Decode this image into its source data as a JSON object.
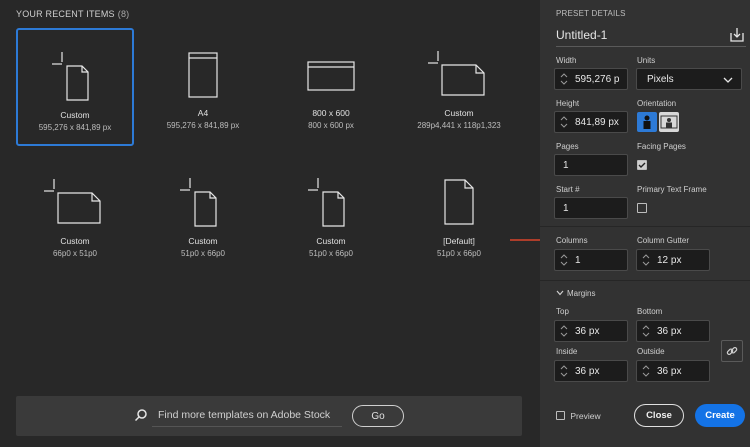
{
  "recent": {
    "title": "YOUR RECENT ITEMS",
    "count": "(8)",
    "items": [
      {
        "name": "Custom",
        "size": "595,276 x 841,89 px",
        "icon": "portrait-page-crop-icon"
      },
      {
        "name": "A4",
        "size": "595,276 x 841,89 px",
        "icon": "browser-page-icon"
      },
      {
        "name": "800 x 600",
        "size": "800 x 600 px",
        "icon": "browser-window-icon"
      },
      {
        "name": "Custom",
        "size": "289p4,441 x 118p1,323",
        "icon": "landscape-page-crop-icon"
      },
      {
        "name": "Custom",
        "size": "66p0 x 51p0",
        "icon": "landscape-page-crop-icon"
      },
      {
        "name": "Custom",
        "size": "51p0 x 66p0",
        "icon": "portrait-page-crop-icon"
      },
      {
        "name": "Custom",
        "size": "51p0 x 66p0",
        "icon": "portrait-page-crop-icon"
      },
      {
        "name": "[Default]",
        "size": "51p0 x 66p0",
        "icon": "portrait-page-icon"
      }
    ]
  },
  "stock": {
    "text": "Find more templates on Adobe Stock",
    "go_label": "Go"
  },
  "preset": {
    "label": "PRESET DETAILS",
    "doc_name": "Untitled-1",
    "width_label": "Width",
    "width_value": "595,276 p",
    "units_label": "Units",
    "units_value": "Pixels",
    "height_label": "Height",
    "height_value": "841,89 px",
    "orientation_label": "Orientation",
    "pages_label": "Pages",
    "pages_value": "1",
    "facing_label": "Facing Pages",
    "facing_checked": true,
    "start_label": "Start #",
    "start_value": "1",
    "ptf_label": "Primary Text Frame",
    "ptf_checked": false,
    "columns_label": "Columns",
    "columns_value": "1",
    "gutter_label": "Column Gutter",
    "gutter_value": "12 px",
    "margins_label": "Margins",
    "top_label": "Top",
    "top_value": "36 px",
    "bottom_label": "Bottom",
    "bottom_value": "36 px",
    "inside_label": "Inside",
    "inside_value": "36 px",
    "outside_label": "Outside",
    "outside_value": "36 px",
    "preview_label": "Preview",
    "close_label": "Close",
    "create_label": "Create"
  },
  "colors": {
    "accent": "#1473e6",
    "selection": "#2d7ad6",
    "annotation_arrow": "#d9442a"
  }
}
